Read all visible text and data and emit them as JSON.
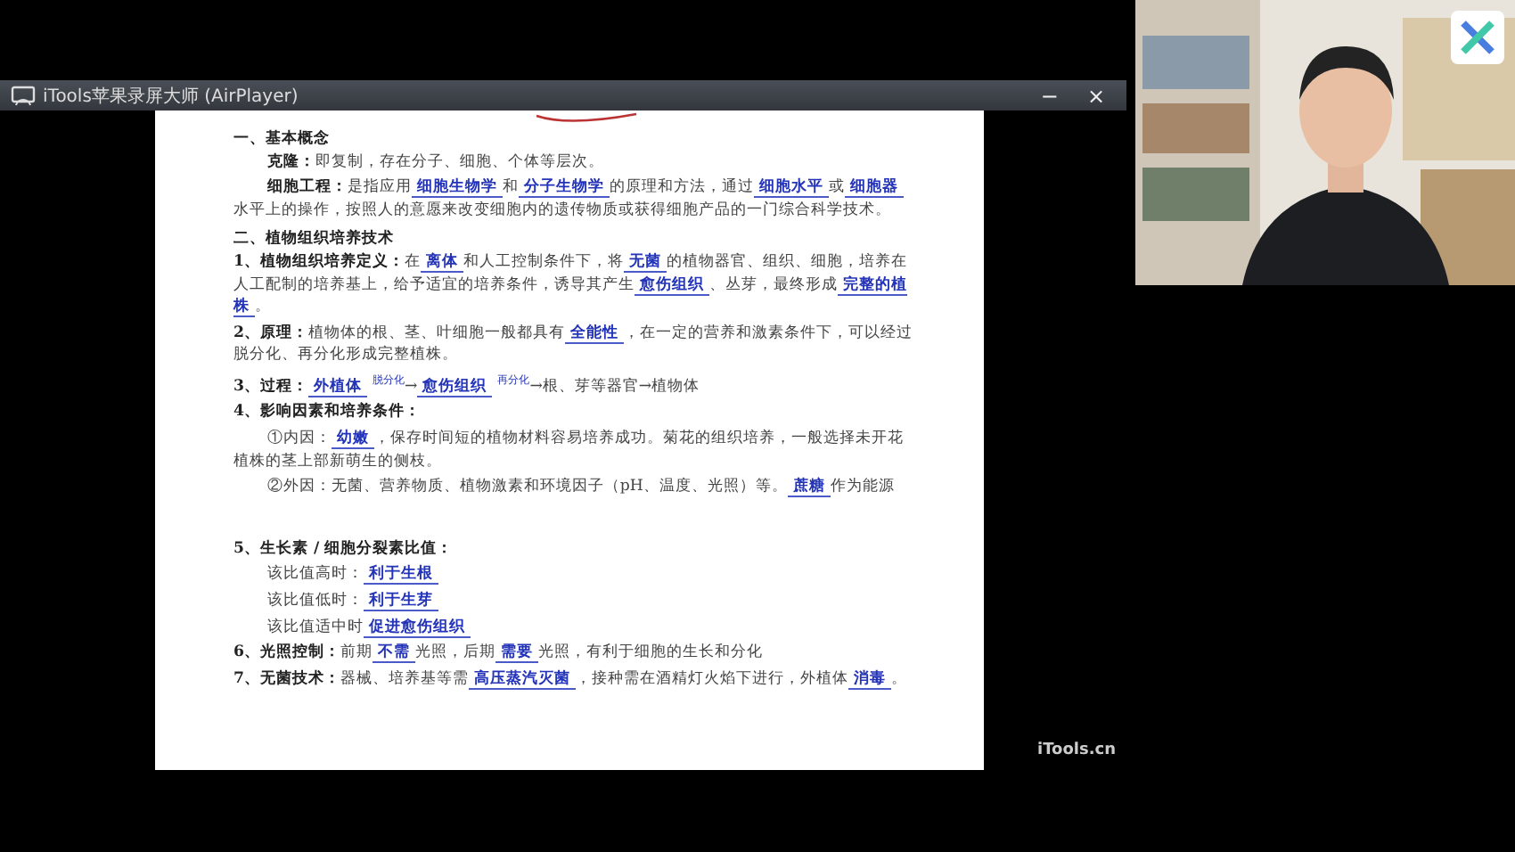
{
  "window": {
    "title": "iTools苹果录屏大师 (AirPlayer)",
    "controls": [
      "−",
      "×"
    ]
  },
  "document": {
    "sections": [
      {
        "heading": "一、基本概念",
        "paragraphs": [
          {
            "kind": "indent",
            "parts": [
              {
                "kind": "label",
                "text": "克隆："
              },
              {
                "kind": "print",
                "text": "即复制，存在分子、细胞、个体等层次。"
              }
            ]
          },
          {
            "kind": "indent",
            "parts": [
              {
                "kind": "label",
                "text": "细胞工程："
              },
              {
                "kind": "print",
                "text": "是指应用"
              },
              {
                "kind": "handwriting",
                "text": "细胞生物学"
              },
              {
                "kind": "print",
                "text": "和"
              },
              {
                "kind": "handwriting",
                "text": "分子生物学"
              },
              {
                "kind": "print",
                "text": "的原理和方法，通过"
              },
              {
                "kind": "handwriting",
                "text": "细胞水平"
              },
              {
                "kind": "print",
                "text": "或"
              },
              {
                "kind": "handwriting",
                "text": "细胞器"
              },
              {
                "kind": "print",
                "text": "水平上的操作，按照人的意愿来改变细胞内的遗传物质或获得细胞产品的一门综合科学技术。"
              }
            ]
          }
        ]
      },
      {
        "heading": "二、植物组织培养技术",
        "paragraphs": [
          {
            "kind": "plain",
            "parts": [
              {
                "kind": "label",
                "text": "1、植物组织培养定义："
              },
              {
                "kind": "print",
                "text": "在"
              },
              {
                "kind": "handwriting",
                "text": "离体"
              },
              {
                "kind": "print",
                "text": "和人工控制条件下，将"
              },
              {
                "kind": "handwriting",
                "text": "无菌"
              },
              {
                "kind": "print",
                "text": "的植物器官、组织、细胞，培养在人工配制的培养基上，给予适宜的培养条件，诱导其产生"
              },
              {
                "kind": "handwriting",
                "text": "愈伤组织"
              },
              {
                "kind": "print",
                "text": "、丛芽，最终形成"
              },
              {
                "kind": "handwriting",
                "text": "完整的植株"
              },
              {
                "kind": "print",
                "text": "。"
              }
            ]
          },
          {
            "kind": "plain",
            "parts": [
              {
                "kind": "label",
                "text": "2、原理："
              },
              {
                "kind": "print",
                "text": "植物体的根、茎、叶细胞一般都具有"
              },
              {
                "kind": "handwriting",
                "text": "全能性"
              },
              {
                "kind": "print",
                "text": "，在一定的营养和激素条件下，可以经过脱分化、再分化形成完整植株。"
              }
            ]
          },
          {
            "kind": "plain",
            "parts": [
              {
                "kind": "label",
                "text": "3、过程："
              },
              {
                "kind": "handwriting",
                "text": "外植体"
              },
              {
                "kind": "note",
                "text": "脱分化"
              },
              {
                "kind": "print",
                "text": "→"
              },
              {
                "kind": "handwriting",
                "text": "愈伤组织"
              },
              {
                "kind": "note",
                "text": "再分化"
              },
              {
                "kind": "print",
                "text": "→根、芽等器官→植物体"
              }
            ]
          },
          {
            "kind": "plain",
            "parts": [
              {
                "kind": "label",
                "text": "4、影响因素和培养条件："
              }
            ]
          },
          {
            "kind": "indent",
            "parts": [
              {
                "kind": "print",
                "text": "①内因："
              },
              {
                "kind": "handwriting",
                "text": "幼嫩"
              },
              {
                "kind": "print",
                "text": "，保存时间短的植物材料容易培养成功。菊花的组织培养，一般选择未开花植株的茎上部新萌生的侧枝。"
              }
            ]
          },
          {
            "kind": "indent",
            "parts": [
              {
                "kind": "print",
                "text": "②外因：无菌、营养物质、植物激素和环境因子（pH、温度、光照）等。"
              },
              {
                "kind": "handwriting",
                "text": "蔗糖"
              },
              {
                "kind": "print",
                "text": "作为能源"
              }
            ]
          },
          {
            "kind": "gap",
            "parts": [
              {
                "kind": "label",
                "text": "5、生长素 / 细胞分裂素比值："
              }
            ]
          },
          {
            "kind": "indent",
            "parts": [
              {
                "kind": "print",
                "text": "该比值高时："
              },
              {
                "kind": "handwriting",
                "text": "利于生根"
              }
            ]
          },
          {
            "kind": "indent",
            "parts": [
              {
                "kind": "print",
                "text": "该比值低时："
              },
              {
                "kind": "handwriting",
                "text": "利于生芽"
              }
            ]
          },
          {
            "kind": "indent",
            "parts": [
              {
                "kind": "print",
                "text": "该比值适中时"
              },
              {
                "kind": "handwriting",
                "text": "促进愈伤组织"
              }
            ]
          },
          {
            "kind": "plain",
            "parts": [
              {
                "kind": "label",
                "text": "6、光照控制："
              },
              {
                "kind": "print",
                "text": "前期"
              },
              {
                "kind": "handwriting",
                "text": "不需"
              },
              {
                "kind": "print",
                "text": "光照，后期"
              },
              {
                "kind": "handwriting",
                "text": "需要"
              },
              {
                "kind": "print",
                "text": "光照，有利于细胞的生长和分化"
              }
            ]
          },
          {
            "kind": "plain",
            "parts": [
              {
                "kind": "label",
                "text": "7、无菌技术："
              },
              {
                "kind": "print",
                "text": "器械、培养基等需"
              },
              {
                "kind": "handwriting",
                "text": "高压蒸汽灭菌"
              },
              {
                "kind": "print",
                "text": "，接种需在酒精灯火焰下进行，外植体"
              },
              {
                "kind": "handwriting",
                "text": "消毒"
              },
              {
                "kind": "print",
                "text": "。"
              }
            ]
          }
        ]
      }
    ]
  },
  "watermark_label": "iTools.cn"
}
